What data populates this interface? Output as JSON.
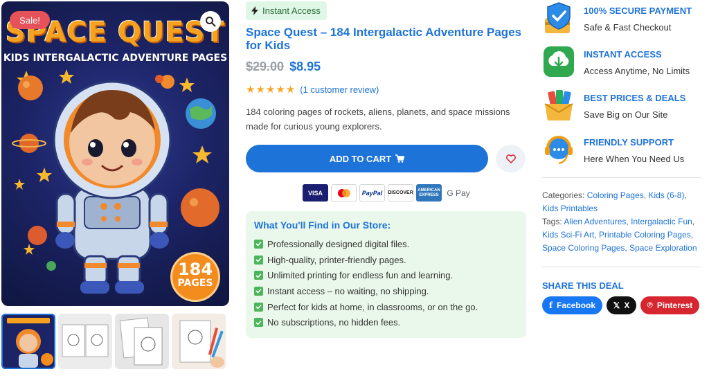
{
  "product_image": {
    "sale_badge": "Sale!",
    "cover_title": "SPACE QUEST",
    "cover_subtitle": "KIDS INTERGALACTIC ADVENTURE PAGES",
    "pages_number": "184",
    "pages_label": "PAGES",
    "thumbnails": [
      {
        "name": "thumbnail-cover"
      },
      {
        "name": "thumbnail-spread"
      },
      {
        "name": "thumbnail-pages"
      },
      {
        "name": "thumbnail-coloring"
      }
    ]
  },
  "product": {
    "access_badge": "Instant Access",
    "title": "Space Quest – 184 Intergalactic Adventure Pages for Kids",
    "old_price": "$29.00",
    "new_price": "$8.95",
    "rating": 5,
    "stars": "★★★★★",
    "review_link": "(1 customer review)",
    "description": "184 coloring pages of rockets, aliens, planets, and space missions made for curious young explorers.",
    "add_to_cart": "ADD TO CART",
    "payment_methods": [
      "VISA",
      "MC",
      "PayPal",
      "DISCOVER",
      "AMERICAN EXPRESS",
      "G Pay"
    ]
  },
  "features": {
    "heading": "What You'll Find in Our Store:",
    "items": [
      "Professionally designed digital files.",
      "High-quality, printer-friendly pages.",
      "Unlimited printing for endless fun and learning.",
      "Instant access – no waiting, no shipping.",
      "Perfect for kids at home, in classrooms, or on the go.",
      "No subscriptions, no hidden fees."
    ]
  },
  "perks": [
    {
      "title": "100% SECURE PAYMENT",
      "sub": "Safe & Fast Checkout",
      "icon": "shield-icon"
    },
    {
      "title": "INSTANT ACCESS",
      "sub": "Access Anytime, No Limits",
      "icon": "download-icon"
    },
    {
      "title": "BEST PRICES & DEALS",
      "sub": "Save Big on Our Site",
      "icon": "deals-icon"
    },
    {
      "title": "FRIENDLY SUPPORT",
      "sub": "Here When You Need Us",
      "icon": "support-icon"
    }
  ],
  "meta": {
    "categories_label": "Categories:",
    "categories": [
      "Coloring Pages",
      "Kids (6-8)",
      "Kids Printables"
    ],
    "tags_label": "Tags:",
    "tags": [
      "Alien Adventures",
      "Intergalactic Fun",
      "Kids Sci-Fi Art",
      "Printable Coloring Pages",
      "Space Coloring Pages",
      "Space Exploration"
    ]
  },
  "share": {
    "title": "SHARE THIS DEAL",
    "facebook": "Facebook",
    "x": "X",
    "pinterest": "Pinterest"
  },
  "colors": {
    "accent": "#1e73d8",
    "sale": "#e5525a",
    "facebook": "#1877f2",
    "x": "#111111",
    "pinterest": "#d6262f"
  }
}
